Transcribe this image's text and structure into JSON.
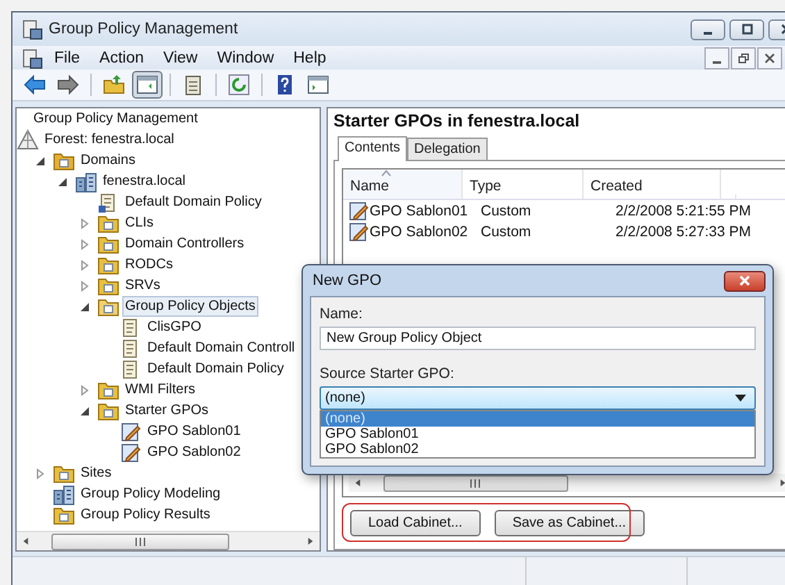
{
  "window": {
    "title": "Group Policy Management"
  },
  "menu": [
    "File",
    "Action",
    "View",
    "Window",
    "Help"
  ],
  "toolbar": [
    {
      "kind": "back",
      "pressed": false
    },
    {
      "kind": "forward",
      "pressed": false
    },
    {
      "kind": "sep"
    },
    {
      "kind": "up",
      "pressed": false
    },
    {
      "kind": "tree",
      "pressed": true
    },
    {
      "kind": "sep"
    },
    {
      "kind": "export",
      "pressed": false
    },
    {
      "kind": "sep"
    },
    {
      "kind": "refresh",
      "pressed": false
    },
    {
      "kind": "sep"
    },
    {
      "kind": "help",
      "pressed": false
    },
    {
      "kind": "pane",
      "pressed": false
    }
  ],
  "tree": [
    {
      "label": "Group Policy Management",
      "selected": false,
      "children": [
        {
          "label": "Forest: fenestra.local",
          "kind": "forest",
          "selected": false,
          "children": [
            {
              "label": "Domains",
              "kind": "domains",
              "expanded": true,
              "selected": false,
              "children": [
                {
                  "label": "fenestra.local",
                  "kind": "domain",
                  "expanded": true,
                  "selected": false,
                  "children": [
                    {
                      "label": "Default Domain Policy",
                      "kind": "gpo-link",
                      "selected": false
                    },
                    {
                      "label": "CLIs",
                      "kind": "ou",
                      "expanded": false,
                      "selected": false
                    },
                    {
                      "label": "Domain Controllers",
                      "kind": "ou",
                      "expanded": false,
                      "selected": false
                    },
                    {
                      "label": "RODCs",
                      "kind": "ou",
                      "expanded": false,
                      "selected": false
                    },
                    {
                      "label": "SRVs",
                      "kind": "ou",
                      "expanded": false,
                      "selected": false
                    },
                    {
                      "label": "Group Policy Objects",
                      "kind": "gpo-folder",
                      "expanded": true,
                      "selected": true,
                      "children": [
                        {
                          "label": "ClisGPO",
                          "kind": "gpo",
                          "selected": false
                        },
                        {
                          "label": "Default Domain Controll",
                          "kind": "gpo",
                          "selected": false
                        },
                        {
                          "label": "Default Domain Policy",
                          "kind": "gpo",
                          "selected": false
                        }
                      ]
                    },
                    {
                      "label": "WMI Filters",
                      "kind": "wmi",
                      "expanded": false,
                      "selected": false
                    },
                    {
                      "label": "Starter GPOs",
                      "kind": "starter-folder",
                      "expanded": true,
                      "selected": false,
                      "children": [
                        {
                          "label": "GPO Sablon01",
                          "kind": "starter-gpo",
                          "selected": false
                        },
                        {
                          "label": "GPO Sablon02",
                          "kind": "starter-gpo",
                          "selected": false
                        }
                      ]
                    }
                  ]
                }
              ]
            },
            {
              "label": "Sites",
              "kind": "sites",
              "expanded": false,
              "selected": false
            },
            {
              "label": "Group Policy Modeling",
              "kind": "modeling",
              "selected": false
            },
            {
              "label": "Group Policy Results",
              "kind": "results",
              "selected": false
            }
          ]
        }
      ]
    }
  ],
  "details": {
    "title": "Starter GPOs in fenestra.local",
    "tabs": [
      {
        "label": "Contents",
        "selected": true
      },
      {
        "label": "Delegation",
        "selected": false
      }
    ],
    "table": {
      "columns": [
        {
          "label": "Name",
          "sorted": true
        },
        {
          "label": "Type",
          "sorted": false
        },
        {
          "label": "Created",
          "sorted": false
        }
      ],
      "rows": [
        {
          "name": "GPO Sablon01",
          "type": "Custom",
          "created": "2/2/2008 5:21:55 PM"
        },
        {
          "name": "GPO Sablon02",
          "type": "Custom",
          "created": "2/2/2008 5:27:33 PM"
        }
      ]
    },
    "buttons": [
      "Load Cabinet...",
      "Save as Cabinet..."
    ]
  },
  "dialog": {
    "title": "New GPO",
    "name_label": "Name:",
    "name_value": "New Group Policy Object",
    "source_label": "Source Starter GPO:",
    "source_value": "(none)",
    "options": [
      {
        "label": "(none)",
        "selected": true
      },
      {
        "label": "GPO Sablon01",
        "selected": false
      },
      {
        "label": "GPO Sablon02",
        "selected": false
      }
    ]
  }
}
